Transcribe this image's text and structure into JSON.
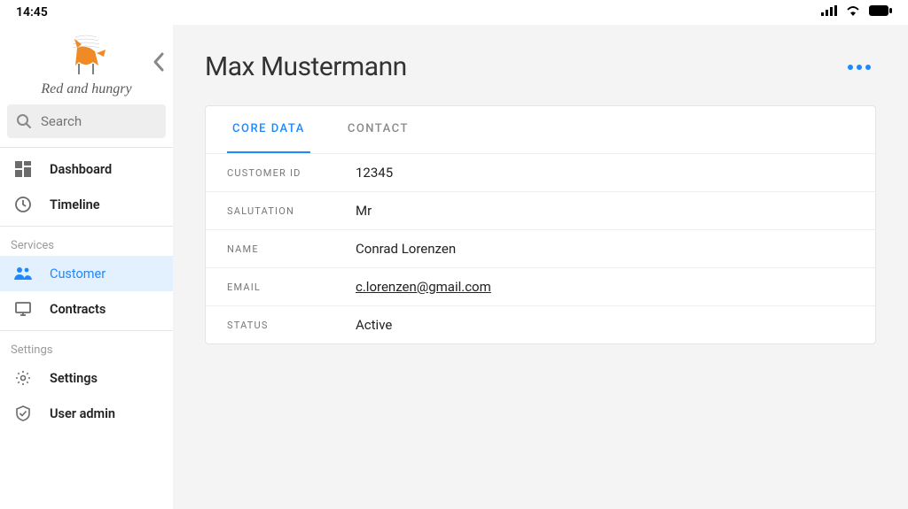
{
  "status": {
    "time": "14:45"
  },
  "brand": {
    "name": "Red and hungry"
  },
  "search": {
    "placeholder": "Search"
  },
  "nav": {
    "top": [
      {
        "label": "Dashboard",
        "icon": "dashboard"
      },
      {
        "label": "Timeline",
        "icon": "clock"
      }
    ],
    "sections": [
      {
        "label": "Services",
        "items": [
          {
            "label": "Customer",
            "icon": "people",
            "active": true
          },
          {
            "label": "Contracts",
            "icon": "monitor"
          }
        ]
      },
      {
        "label": "Settings",
        "items": [
          {
            "label": "Settings",
            "icon": "gear"
          },
          {
            "label": "User admin",
            "icon": "shield"
          }
        ]
      }
    ]
  },
  "page": {
    "title": "Max Mustermann"
  },
  "tabs": [
    {
      "label": "CORE DATA",
      "active": true
    },
    {
      "label": "CONTACT"
    }
  ],
  "fields": [
    {
      "label": "CUSTOMER ID",
      "value": "12345"
    },
    {
      "label": "SALUTATION",
      "value": "Mr"
    },
    {
      "label": "NAME",
      "value": "Conrad Lorenzen"
    },
    {
      "label": "EMAIL",
      "value": "c.lorenzen@gmail.com",
      "link": true
    },
    {
      "label": "STATUS",
      "value": "Active"
    }
  ]
}
